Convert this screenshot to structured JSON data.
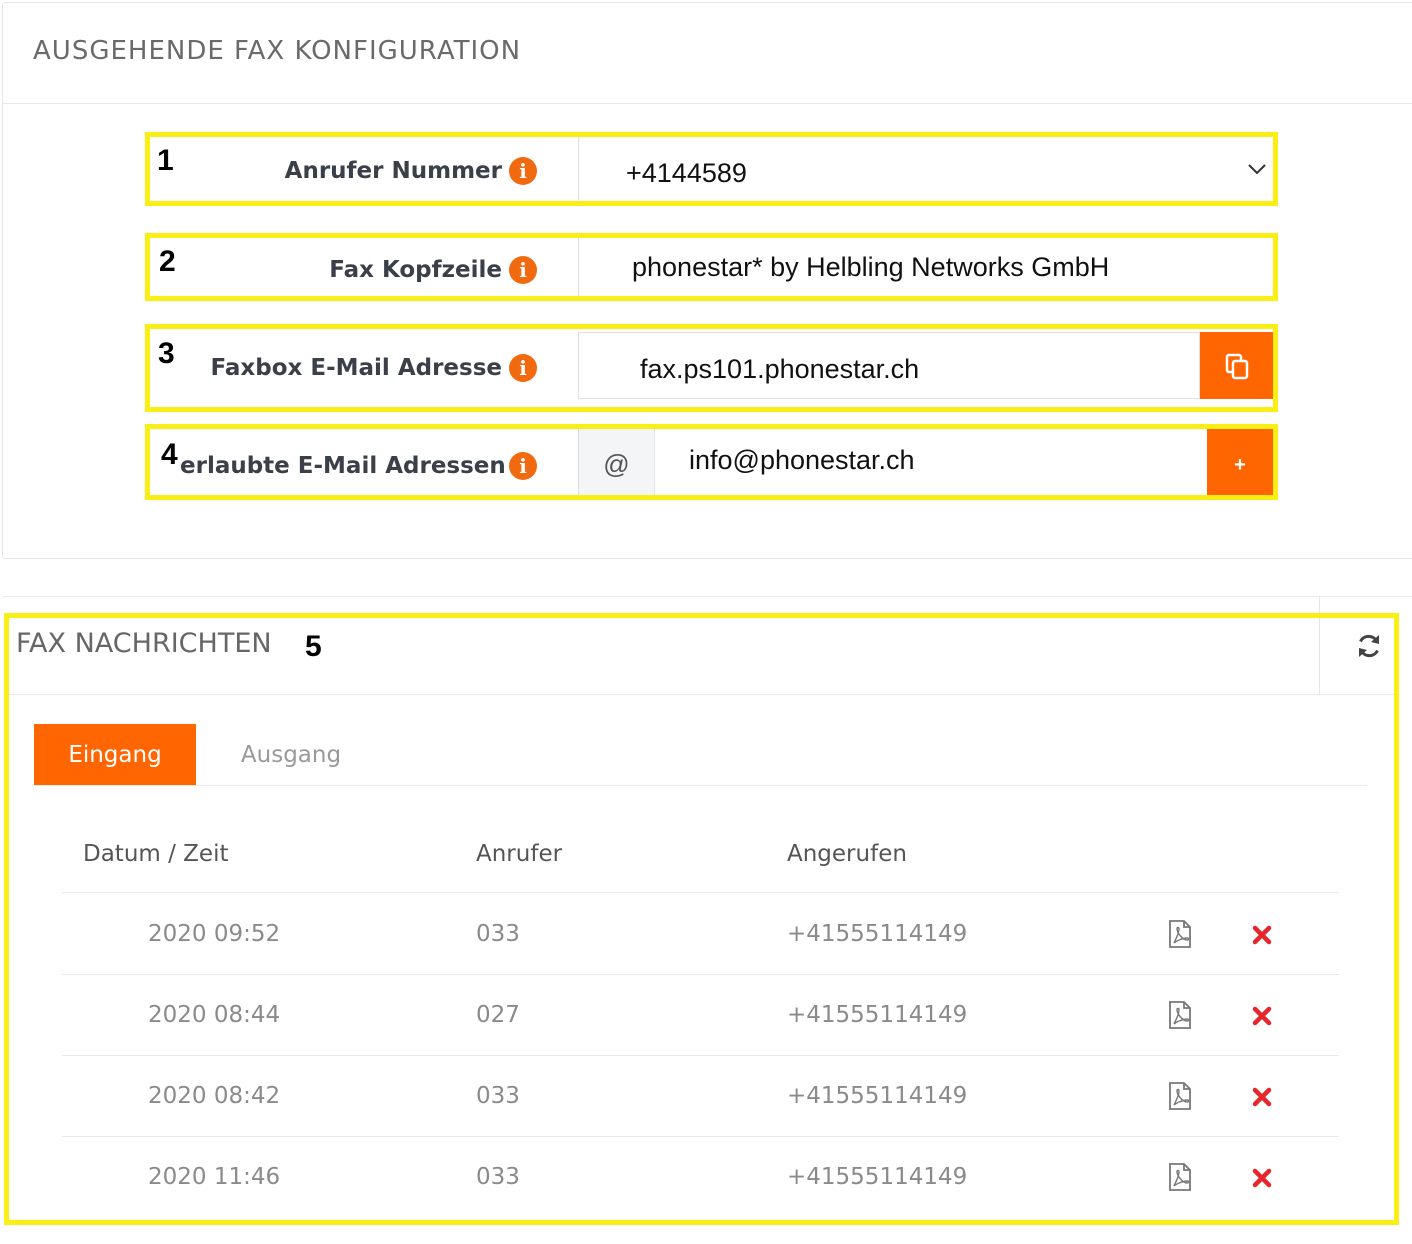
{
  "config": {
    "title": "AUSGEHENDE FAX KONFIGURATION",
    "rows": [
      {
        "number": "1",
        "label": "Anrufer Nummer",
        "value": "+4144589"
      },
      {
        "number": "2",
        "label": "Fax Kopfzeile",
        "value": "phonestar* by Helbling Networks GmbH"
      },
      {
        "number": "3",
        "label": "Faxbox E-Mail Adresse",
        "value": "fax.ps101.phonestar.ch"
      },
      {
        "number": "4",
        "label": "erlaubte E-Mail Adressen",
        "addon": "@",
        "value": "info@phonestar.ch",
        "add_label": "+"
      }
    ]
  },
  "fax_messages": {
    "title": "FAX NACHRICHTEN",
    "number": "5",
    "tabs": [
      {
        "label": "Eingang",
        "active": true
      },
      {
        "label": "Ausgang",
        "active": false
      }
    ],
    "columns": [
      "Datum / Zeit",
      "Anrufer",
      "Angerufen"
    ],
    "rows": [
      {
        "datetime": "2020 09:52",
        "caller": "033",
        "called": "+41555114149"
      },
      {
        "datetime": "2020 08:44",
        "caller": "027",
        "called": "+41555114149"
      },
      {
        "datetime": "2020 08:42",
        "caller": "033",
        "called": "+41555114149"
      },
      {
        "datetime": "2020 11:46",
        "caller": "033",
        "called": "+41555114149"
      }
    ]
  },
  "colors": {
    "accent": "#ff6500",
    "highlight": "#f9ef14",
    "delete": "#e5262d"
  },
  "icons": {
    "info": "info-icon",
    "dropdown": "chevron-down-icon",
    "copy": "copy-icon",
    "refresh": "refresh-icon",
    "pdf": "pdf-file-icon",
    "delete": "delete-x-icon"
  }
}
